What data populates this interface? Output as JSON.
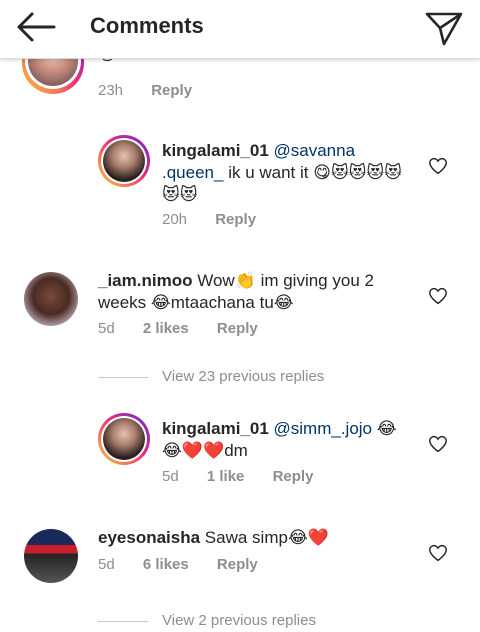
{
  "header": {
    "title": "Comments",
    "back_icon": "back-arrow-icon",
    "send_icon": "paper-plane-icon"
  },
  "comments": [
    {
      "partial_emoji": "😂",
      "time": "23h",
      "reply": "Reply"
    },
    {
      "username": "kingalami_01",
      "mention": "@savanna .queen_",
      "text": "ik u want it 😋😻😻😻😻😻😻",
      "time": "20h",
      "reply": "Reply"
    },
    {
      "username": "_iam.nimoo",
      "text": "Wow👏 im giving you 2 weeks 😂mtaachana tu😂",
      "time": "5d",
      "likes": "2 likes",
      "reply": "Reply"
    },
    {
      "view_replies": "View 23 previous replies"
    },
    {
      "username": "kingalami_01",
      "mention": "@simm_.jojo",
      "text": "😂😂❤️❤️dm",
      "time": "5d",
      "likes": "1 like",
      "reply": "Reply"
    },
    {
      "username": "eyesonaisha",
      "text": "Sawa simp😂❤️",
      "time": "5d",
      "likes": "6 likes",
      "reply": "Reply"
    },
    {
      "view_replies": "View 2 previous replies"
    }
  ],
  "colors": {
    "mention": "#003569",
    "meta": "#8e8e8e",
    "ring_start": "#f9ce34",
    "ring_mid": "#ee2a7b",
    "ring_end": "#6228d7"
  }
}
